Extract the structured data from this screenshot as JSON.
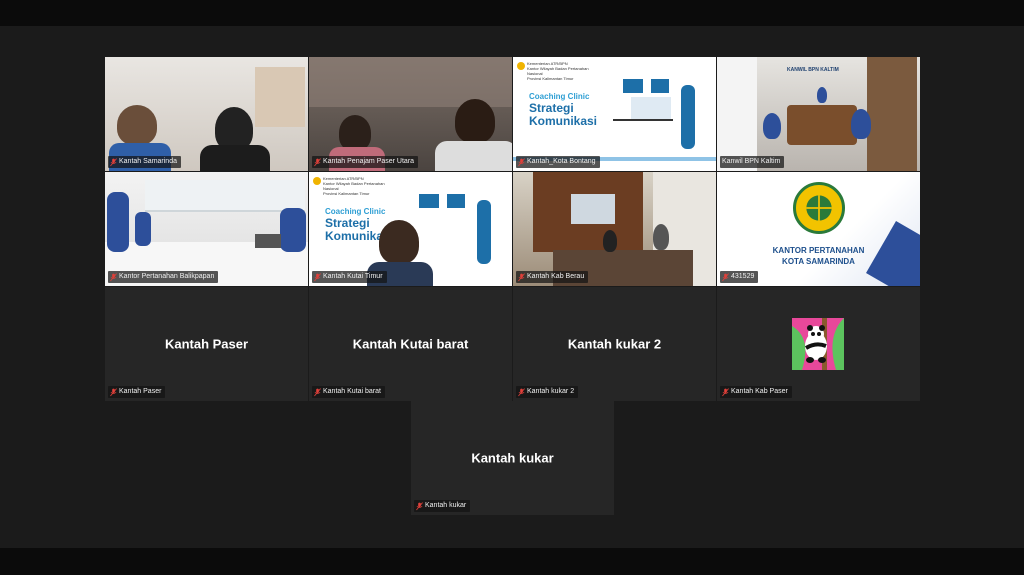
{
  "participants": [
    {
      "name": "Kantah Samarinda"
    },
    {
      "name": "Kantah Penajam Paser Utara"
    },
    {
      "name": "Kantah_Kota Bontang",
      "slide": {
        "header": "Kementerian ATR/BPN\nKantor Wilayah Badan Pertanahan Nasional\nProvinsi Kalimantan Timur",
        "subtitle": "Coaching Clinic",
        "title": "Strategi\nKomunikasi"
      }
    },
    {
      "name": "Kanwil BPN Kaltim",
      "sign": "KANWIL BPN KALTIM"
    },
    {
      "name": "Kantor Pertanahan Balikpapan"
    },
    {
      "name": "Kantah Kutai Timur",
      "slide": {
        "header": "Kementerian ATR/BPN\nKantor Wilayah Badan Pertanahan Nasional\nProvinsi Kalimantan Timur",
        "subtitle": "Coaching Clinic",
        "title": "Strategi\nKomunika"
      }
    },
    {
      "name": "Kantah Kab Berau"
    },
    {
      "name": "431529",
      "org_lines": [
        "KANTOR PERTANAHAN",
        "KOTA SAMARINDA"
      ]
    },
    {
      "name": "Kantah Paser",
      "display": "Kantah Paser"
    },
    {
      "name": "Kantah Kutai barat",
      "display": "Kantah Kutai barat"
    },
    {
      "name": "Kantah kukar 2",
      "display": "Kantah kukar 2"
    },
    {
      "name": "Kantah Kab Paser"
    },
    {
      "name": "Kantah kukar",
      "display": "Kantah kukar"
    }
  ],
  "colors": {
    "active_speaker": "#46c22f",
    "tile_bg": "#262626",
    "muted_mic": "#e0403a"
  }
}
